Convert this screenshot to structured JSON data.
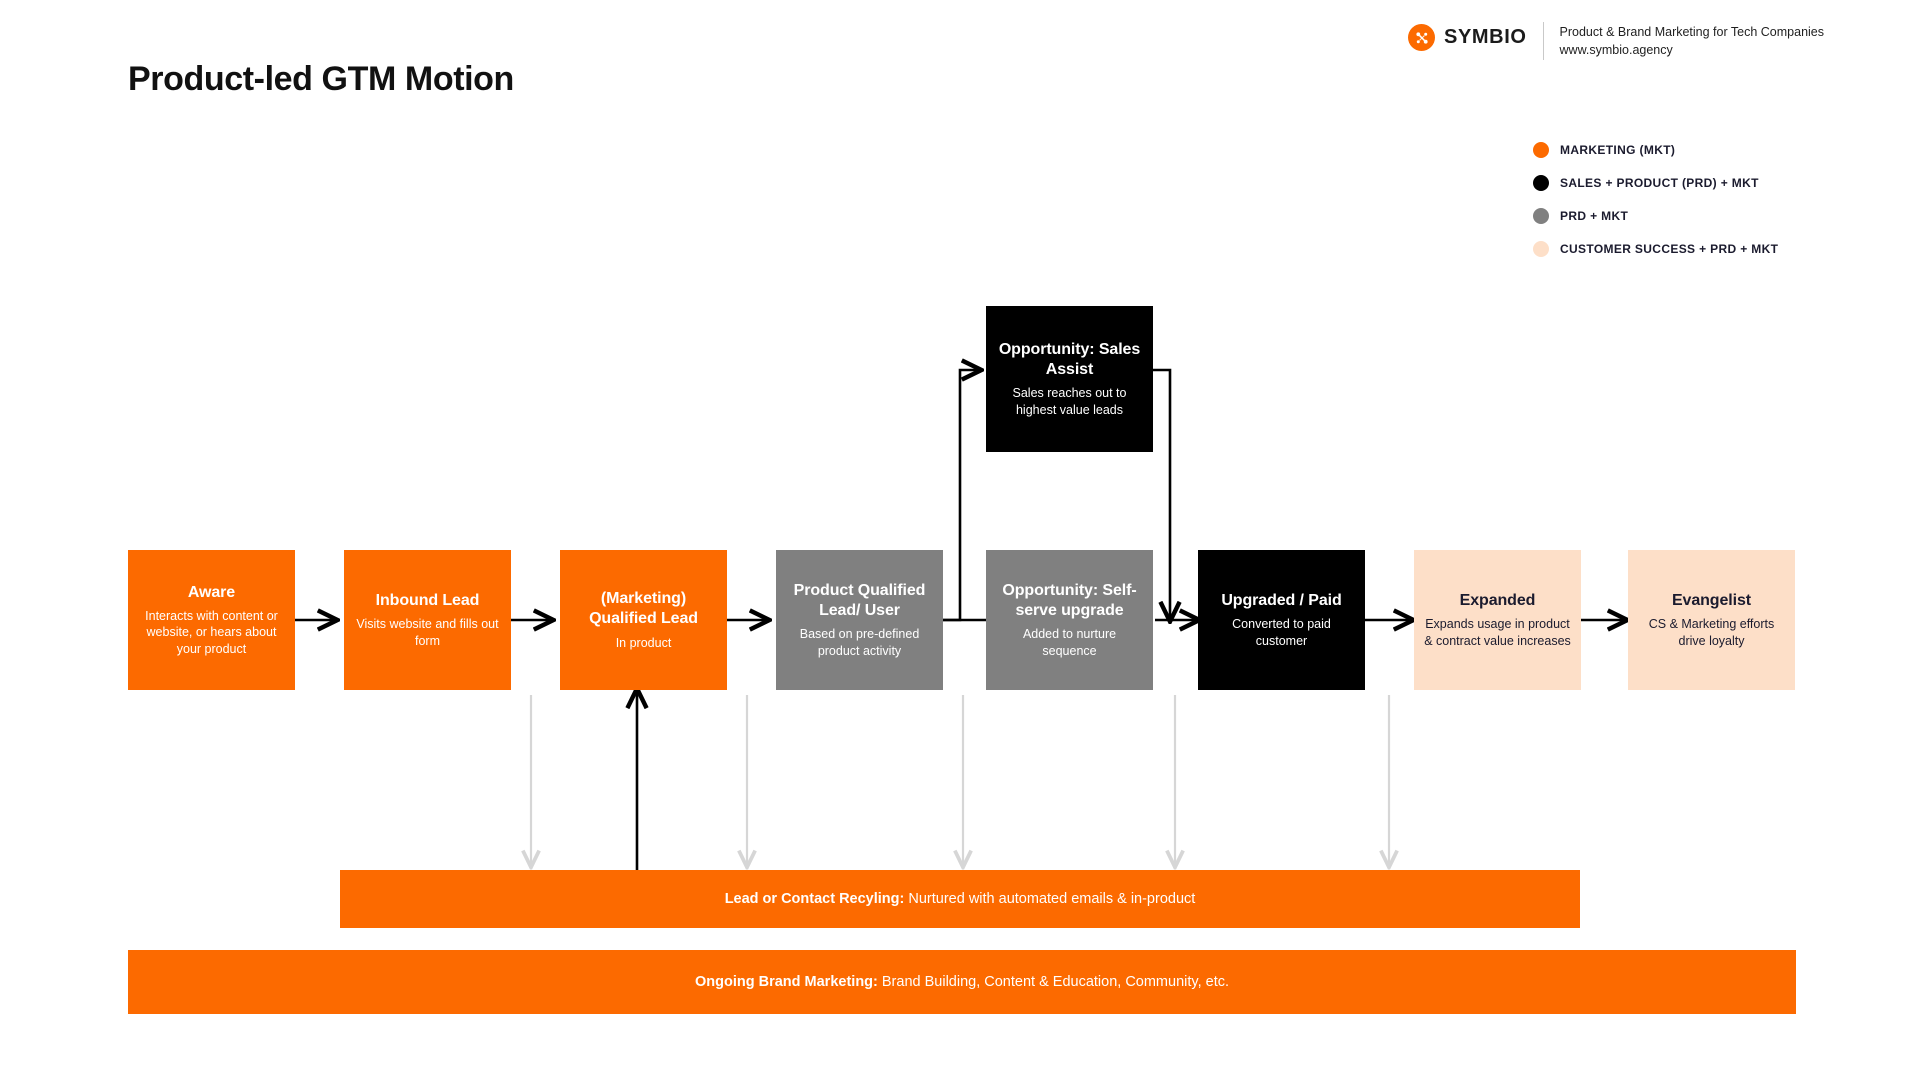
{
  "header": {
    "title": "Product-led GTM Motion",
    "brand_name": "SYMBIO",
    "brand_tagline_line1": "Product & Brand Marketing for Tech Companies",
    "brand_tagline_line2": "www.symbio.agency"
  },
  "colors": {
    "orange": "#FC6A00",
    "black": "#000000",
    "gray": "#808080",
    "peach": "#FDDFC8",
    "arrow": "#000000",
    "recycle_arrow": "#d6d6d6"
  },
  "legend": {
    "items": [
      {
        "label": "MARKETING (MKT)",
        "color": "#FC6A00"
      },
      {
        "label": "SALES + PRODUCT (PRD)  + MKT",
        "color": "#000000"
      },
      {
        "label": "PRD + MKT",
        "color": "#808080"
      },
      {
        "label": "CUSTOMER SUCCESS + PRD + MKT",
        "color": "#FDDFC8"
      }
    ]
  },
  "flow": {
    "nodes": [
      {
        "id": "aware",
        "title": "Aware",
        "desc": "Interacts with content or website, or hears about your product",
        "fill": "#FC6A00",
        "text": "light"
      },
      {
        "id": "inbound",
        "title": "Inbound Lead",
        "desc": "Visits website and fills out form",
        "fill": "#FC6A00",
        "text": "light"
      },
      {
        "id": "mql",
        "title": "(Marketing) Qualified Lead",
        "desc": "In product",
        "fill": "#FC6A00",
        "text": "light"
      },
      {
        "id": "pql",
        "title": "Product Qualified Lead/ User",
        "desc": "Based on pre-defined product activity",
        "fill": "#808080",
        "text": "light"
      },
      {
        "id": "sales",
        "title": "Opportunity: Sales Assist",
        "desc": "Sales reaches out to highest value leads",
        "fill": "#000000",
        "text": "light"
      },
      {
        "id": "selfserve",
        "title": "Opportunity: Self-serve upgrade",
        "desc": "Added to nurture sequence",
        "fill": "#808080",
        "text": "light"
      },
      {
        "id": "upgraded",
        "title": "Upgraded / Paid",
        "desc": "Converted to paid customer",
        "fill": "#000000",
        "text": "light"
      },
      {
        "id": "expanded",
        "title": "Expanded",
        "desc": "Expands usage in product & contract value increases",
        "fill": "#FDDFC8",
        "text": "dark"
      },
      {
        "id": "evangelist",
        "title": "Evangelist",
        "desc": "CS & Marketing efforts drive loyalty",
        "fill": "#FDDFC8",
        "text": "dark"
      }
    ]
  },
  "bars": {
    "recycling": {
      "bold": "Lead or Contact Recyling:",
      "rest": " Nurtured with automated emails & in-product"
    },
    "branding": {
      "bold": "Ongoing Brand Marketing:",
      "rest": " Brand Building, Content & Education, Community, etc."
    }
  }
}
